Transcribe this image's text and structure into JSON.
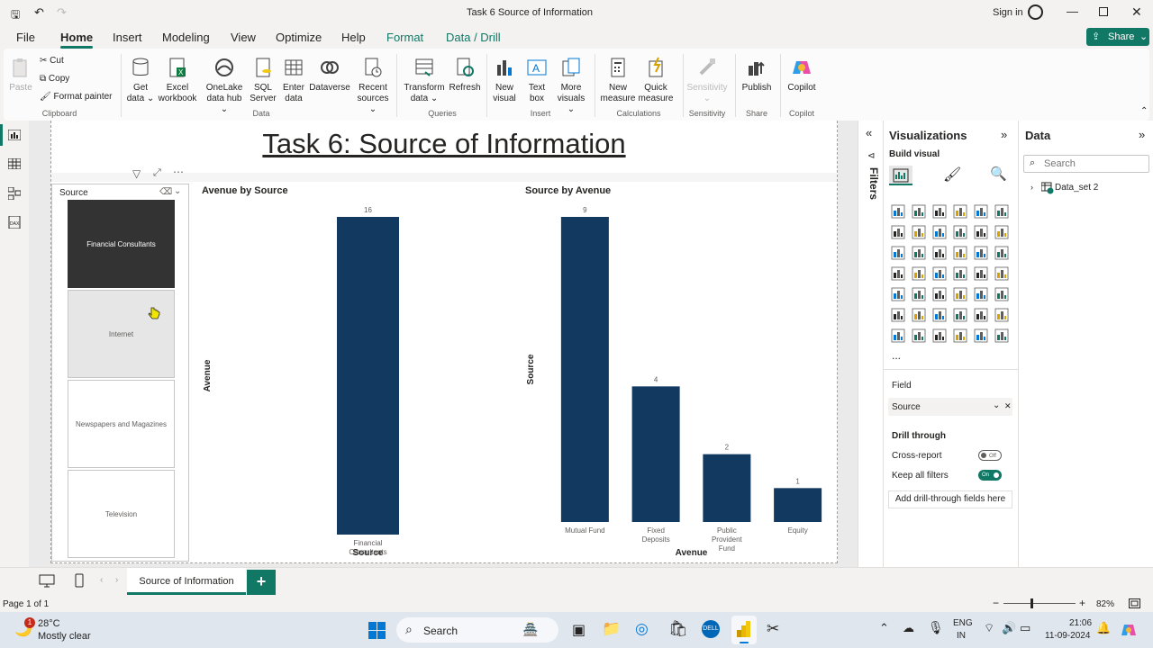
{
  "app": {
    "window_title": "Task 6 Source of Information",
    "sign_in": "Sign in",
    "share": "Share"
  },
  "menu": [
    "File",
    "Home",
    "Insert",
    "Modeling",
    "View",
    "Optimize",
    "Help",
    "Format",
    "Data / Drill"
  ],
  "ribbon": {
    "clipboard": {
      "paste": "Paste",
      "cut": "Cut",
      "copy": "Copy",
      "format_painter": "Format painter",
      "group": "Clipboard"
    },
    "data": {
      "get_data_1": "Get",
      "get_data_2": "data ⌄",
      "excel_1": "Excel",
      "excel_2": "workbook",
      "onelake_1": "OneLake",
      "onelake_2": "data hub ⌄",
      "sql_1": "SQL",
      "sql_2": "Server",
      "enter_1": "Enter",
      "enter_2": "data",
      "dataverse": "Dataverse",
      "recent_1": "Recent",
      "recent_2": "sources ⌄",
      "group": "Data"
    },
    "queries": {
      "transform_1": "Transform",
      "transform_2": "data ⌄",
      "refresh": "Refresh",
      "group": "Queries"
    },
    "insert": {
      "new_visual_1": "New",
      "new_visual_2": "visual",
      "text_box_1": "Text",
      "text_box_2": "box",
      "more_1": "More",
      "more_2": "visuals ⌄",
      "group": "Insert"
    },
    "calculations": {
      "new_measure_1": "New",
      "new_measure_2": "measure",
      "quick_measure_1": "Quick",
      "quick_measure_2": "measure",
      "group": "Calculations"
    },
    "sensitivity": {
      "label": "Sensitivity",
      "group": "Sensitivity"
    },
    "share": {
      "publish": "Publish",
      "group": "Share"
    },
    "copilot": {
      "label": "Copilot",
      "group": "Copilot"
    }
  },
  "report": {
    "title": "Task 6: Source of Information",
    "slicer": {
      "title": "Source",
      "items": [
        "Financial Consultants",
        "Internet",
        "Newspapers and Magazines",
        "Television"
      ]
    }
  },
  "chart_data": [
    {
      "type": "bar",
      "title": "Avenue by Source",
      "xlabel": "Source",
      "ylabel": "Avenue",
      "categories": [
        "Financial Consultants"
      ],
      "values": [
        16
      ],
      "ylim": [
        0,
        16
      ],
      "bar_color": "#12395f",
      "grid": false
    },
    {
      "type": "bar",
      "title": "Source by Avenue",
      "xlabel": "Avenue",
      "ylabel": "Source",
      "categories": [
        "Mutual Fund",
        "Fixed Deposits",
        "Public Provident Fund",
        "Equity"
      ],
      "values": [
        9,
        4,
        2,
        1
      ],
      "ylim": [
        0,
        9
      ],
      "bar_color": "#12395f",
      "grid": false
    }
  ],
  "filters_label": "Filters",
  "viz_pane": {
    "title": "Visualizations",
    "build_visual": "Build visual",
    "more": "...",
    "field_label": "Field",
    "field_value": "Source",
    "drill_through": "Drill through",
    "cross_report": "Cross-report",
    "cross_report_state": "Off",
    "keep_all_filters": "Keep all filters",
    "keep_state": "On",
    "add_drill": "Add drill-through fields here"
  },
  "data_pane": {
    "title": "Data",
    "search_placeholder": "Search",
    "table": "Data_set 2"
  },
  "pages": {
    "tab": "Source of Information",
    "add": "+"
  },
  "status": {
    "page": "Page 1 of 1",
    "zoom": "82%",
    "minus": "−",
    "plus": "+"
  },
  "taskbar": {
    "weather_temp": "28°C",
    "weather_desc": "Mostly clear",
    "weather_badge": "1",
    "search": "Search",
    "lang_1": "ENG",
    "lang_2": "IN",
    "time": "21:06",
    "date": "11-09-2024"
  },
  "colors": {
    "accent": "#117865",
    "bar": "#12395f",
    "slicer_selected": "#333333"
  }
}
